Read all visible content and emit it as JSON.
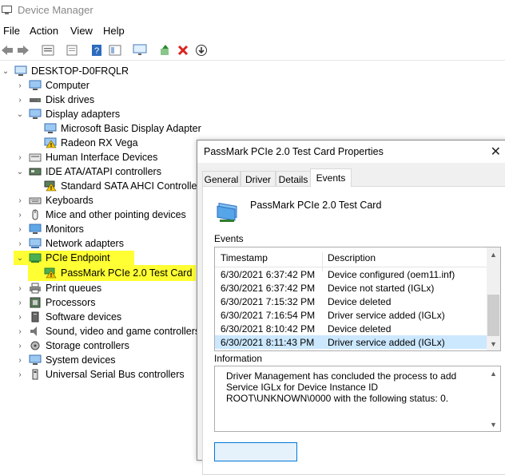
{
  "window": {
    "title": "Device Manager"
  },
  "menu": [
    "File",
    "Action",
    "View",
    "Help"
  ],
  "toolbar": [
    "back-icon",
    "forward-icon",
    "properties-icon",
    "refresh-icon",
    "help-icon",
    "view-icon",
    "monitor-icon",
    "update-driver-icon",
    "uninstall-icon",
    "download-icon"
  ],
  "tree": {
    "root": "DESKTOP-D0FRQLR",
    "items": [
      {
        "label": "Computer"
      },
      {
        "label": "Disk drives"
      },
      {
        "label": "Display adapters"
      },
      {
        "label": "Microsoft Basic Display Adapter"
      },
      {
        "label": "Radeon RX Vega"
      },
      {
        "label": "Human Interface Devices"
      },
      {
        "label": "IDE ATA/ATAPI controllers"
      },
      {
        "label": "Standard SATA AHCI Controller"
      },
      {
        "label": "Keyboards"
      },
      {
        "label": "Mice and other pointing devices"
      },
      {
        "label": "Monitors"
      },
      {
        "label": "Network adapters"
      },
      {
        "label": "PCIe Endpoint"
      },
      {
        "label": "PassMark PCIe 2.0 Test Card"
      },
      {
        "label": "Print queues"
      },
      {
        "label": "Processors"
      },
      {
        "label": "Software devices"
      },
      {
        "label": "Sound, video and game controllers"
      },
      {
        "label": "Storage controllers"
      },
      {
        "label": "System devices"
      },
      {
        "label": "Universal Serial Bus controllers"
      }
    ]
  },
  "dialog": {
    "title": "PassMark PCIe 2.0 Test Card Properties",
    "tabs": [
      "General",
      "Driver",
      "Details",
      "Events"
    ],
    "active_tab": "Events",
    "device_name": "PassMark PCIe 2.0 Test Card",
    "events_label": "Events",
    "columns": [
      "Timestamp",
      "Description"
    ],
    "events": [
      {
        "ts": "6/30/2021 6:37:42 PM",
        "desc": "Device configured (oem11.inf)"
      },
      {
        "ts": "6/30/2021 6:37:42 PM",
        "desc": "Device not started (IGLx)"
      },
      {
        "ts": "6/30/2021 7:15:32 PM",
        "desc": "Device deleted"
      },
      {
        "ts": "6/30/2021 7:16:54 PM",
        "desc": "Driver service added (IGLx)"
      },
      {
        "ts": "6/30/2021 8:10:42 PM",
        "desc": "Device deleted"
      },
      {
        "ts": "6/30/2021 8:11:43 PM",
        "desc": "Driver service added (IGLx)"
      }
    ],
    "info_label": "Information",
    "info_text": "Driver Management has concluded the process to add Service IGLx for Device Instance ID ROOT\\UNKNOWN\\0000 with the following status: 0."
  },
  "colors": {
    "highlight": "#ffff33",
    "selection": "#cce8ff",
    "accent": "#0078d7"
  }
}
